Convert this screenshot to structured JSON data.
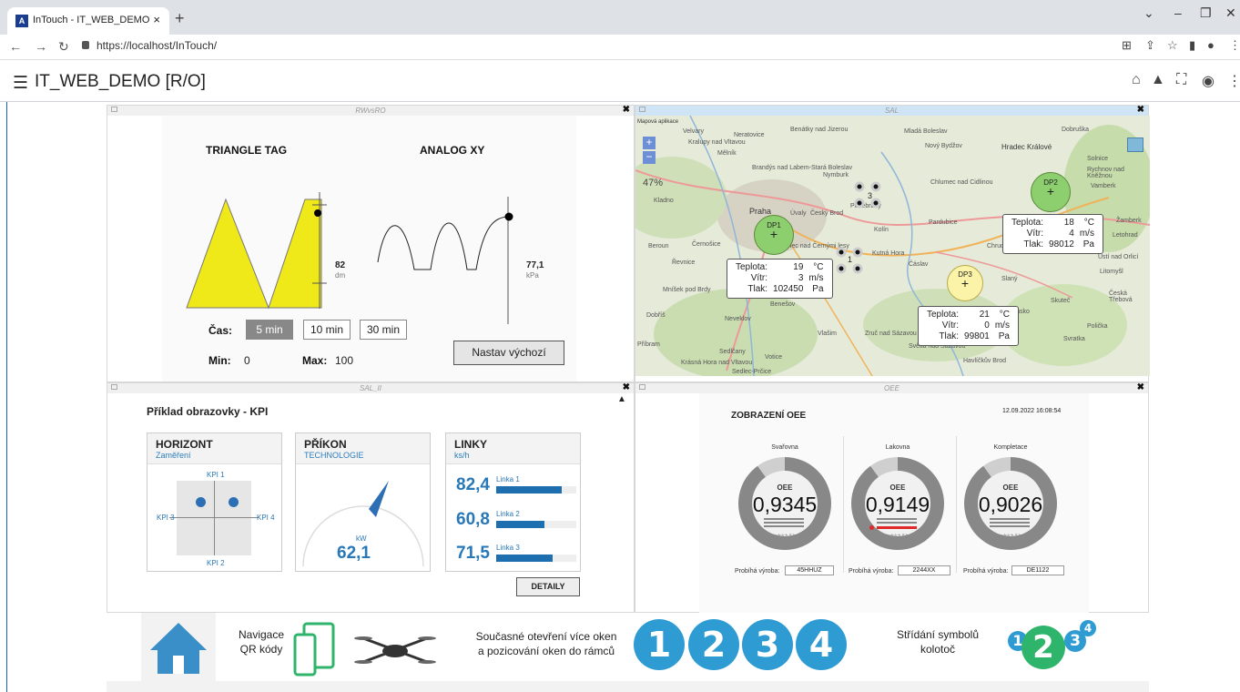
{
  "browser": {
    "tab_title": "InTouch - IT_WEB_DEMO",
    "tab_close": "×",
    "new_tab": "+",
    "url": "https://localhost/InTouch/"
  },
  "app": {
    "title": "IT_WEB_DEMO  [R/O]"
  },
  "win1": {
    "title": "RWvsRO",
    "triangle_label": "TRIANGLE TAG",
    "analog_label": "ANALOG XY",
    "tri_value": "82",
    "tri_unit": "dm",
    "xy_value": "77,1",
    "xy_unit": "kPa",
    "time_label": "Čas:",
    "btn_5": "5 min",
    "btn_10": "10 min",
    "btn_30": "30 min",
    "min_label": "Min:",
    "min_value": "0",
    "max_label": "Max:",
    "max_value": "100",
    "default_btn": "Nastav výchozí"
  },
  "win2": {
    "title": "SAL",
    "map_app": "Mapová aplikace",
    "zoom_in": "+",
    "zoom_out": "−",
    "cities": [
      "Velvary",
      "Kralupy nad Vltavou",
      "Neratovice",
      "Benátky nad Jizerou",
      "Brandýs nad Labem-Stará Boleslav",
      "Mladá Boleslav",
      "Kladno",
      "Praha",
      "Úvaly",
      "Český Brod",
      "Nymburk",
      "Kolín",
      "Poděbrady",
      "Hradec Králové",
      "Chlumec nad Cidlinou",
      "Beroun",
      "Řevnice",
      "Černošice",
      "Kostelec nad Černými lesy",
      "Kutná Hora",
      "Čáslav",
      "Pardubice",
      "Chrudim",
      "Mníšek pod Brdy",
      "Dobříš",
      "Benešov",
      "Neveklov",
      "Vlašim",
      "Zruč nad Sázavou",
      "Příbram",
      "Sedlčany",
      "Votice",
      "Krásná Hora nad Vltavou",
      "Sedlec-Prčice",
      "Světlá nad Sázavou",
      "Havlíčkův Brod",
      "Žamberk",
      "Letohrad",
      "Ústí nad Orlicí",
      "Česká Třebová",
      "Litomyšl",
      "Skuteč",
      "Hlinsko",
      "Polička",
      "Svratka",
      "Solnice",
      "Rychnov nad Kněžnou",
      "Vamberk",
      "Dobruška",
      "Nový Bydžov",
      "Mělník",
      "Slaný"
    ],
    "stations": [
      {
        "name": "DP1",
        "teplota": "19",
        "vitr": "3",
        "tlak": "102450"
      },
      {
        "name": "DP2",
        "teplota": "18",
        "vitr": "4",
        "tlak": "98012"
      },
      {
        "name": "DP3",
        "teplota": "21",
        "vitr": "0",
        "tlak": "99801"
      }
    ],
    "labels": {
      "teplota": "Teplota:",
      "vitr": "Vítr:",
      "tlak": "Tlak:",
      "u_t": "°C",
      "u_v": "m/s",
      "u_p": "Pa"
    },
    "cluster1": "3",
    "cluster2": "1",
    "pct": "47%"
  },
  "win3": {
    "title": "SAL_II",
    "heading": "Příklad obrazovky - KPI",
    "horizont": {
      "title": "HORIZONT",
      "sub": "Zaměření",
      "k1": "KPI 1",
      "k2": "KPI 2",
      "k3": "KPI 3",
      "k4": "KPI 4"
    },
    "prikon": {
      "title": "PŘÍKON",
      "sub": "TECHNOLOGIE",
      "unit": "kW",
      "value": "62,1",
      "fraction": 0.62
    },
    "linky": {
      "title": "LINKY",
      "sub": "ks/h",
      "items": [
        {
          "value": "82,4",
          "name": "Linka 1",
          "fill": 0.82
        },
        {
          "value": "60,8",
          "name": "Linka 2",
          "fill": 0.6
        },
        {
          "value": "71,5",
          "name": "Linka 3",
          "fill": 0.71
        }
      ]
    },
    "detail_btn": "DETAILY"
  },
  "win4": {
    "title": "OEE",
    "heading": "ZOBRAZENÍ OEE",
    "date": "12.09.2022  16:08:54",
    "oee_label": "OEE",
    "subnote": "Posledních 8 hodin",
    "run_label": "Probíhá výroba:",
    "gauges": [
      {
        "name": "Svařovna",
        "value": "0,9345",
        "order": "45HHUZ"
      },
      {
        "name": "Lakovna",
        "value": "0,9149",
        "order": "2244XX"
      },
      {
        "name": "Kompletace",
        "value": "0,9026",
        "order": "DE1122"
      }
    ]
  },
  "footer": {
    "nav_text": "Navigace\nQR kódy",
    "multi_text": "Současné otevření více oken\na pozicování oken do rámců",
    "rot_text": "Střídání symbolů\nkolotoč",
    "n1": "1",
    "n2": "2",
    "n3": "3",
    "n4": "4",
    "colors": {
      "blue": "#2e9bd3",
      "green": "#2fb56b",
      "home": "#3a8fc9"
    }
  }
}
